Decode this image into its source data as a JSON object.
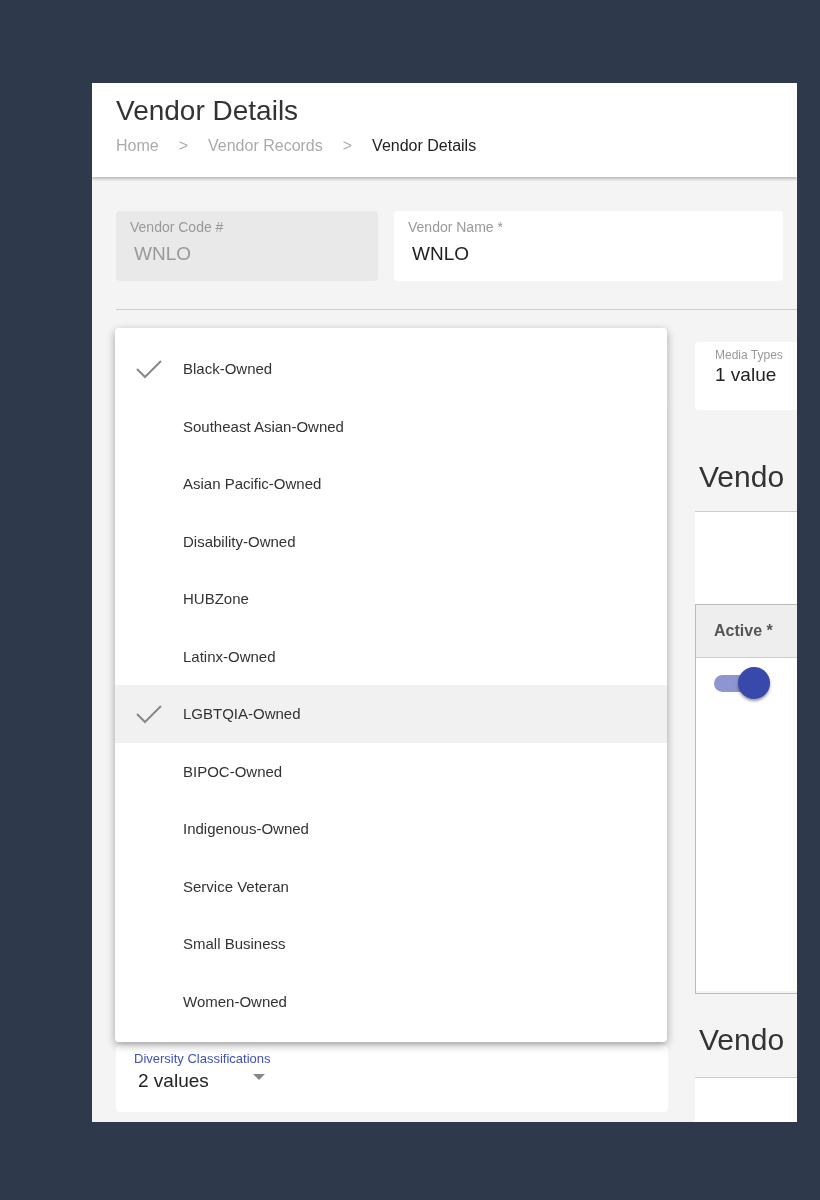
{
  "page_title": "Vendor Details",
  "breadcrumb": [
    {
      "label": "Home",
      "current": false
    },
    {
      "label": "Vendor Records",
      "current": false
    },
    {
      "label": "Vendor Details",
      "current": true
    }
  ],
  "breadcrumb_separator": ">",
  "fields": [
    {
      "label": "Vendor Code #",
      "value": "WNLO",
      "disabled": true
    },
    {
      "label": "Vendor Name *",
      "value": "WNLO",
      "disabled": false
    }
  ],
  "diversity_menu": [
    {
      "label": "Black-Owned",
      "checked": true,
      "highlighted": false
    },
    {
      "label": "Southeast Asian-Owned",
      "checked": false,
      "highlighted": false
    },
    {
      "label": "Asian Pacific-Owned",
      "checked": false,
      "highlighted": false
    },
    {
      "label": "Disability-Owned",
      "checked": false,
      "highlighted": false
    },
    {
      "label": "HUBZone",
      "checked": false,
      "highlighted": false
    },
    {
      "label": "Latinx-Owned",
      "checked": false,
      "highlighted": false
    },
    {
      "label": "LGBTQIA-Owned",
      "checked": true,
      "highlighted": true
    },
    {
      "label": "BIPOC-Owned",
      "checked": false,
      "highlighted": false
    },
    {
      "label": "Indigenous-Owned",
      "checked": false,
      "highlighted": false
    },
    {
      "label": "Service Veteran",
      "checked": false,
      "highlighted": false
    },
    {
      "label": "Small Business",
      "checked": false,
      "highlighted": false
    },
    {
      "label": "Women-Owned",
      "checked": false,
      "highlighted": false
    }
  ],
  "diversity_field": {
    "label": "Diversity Classifications",
    "value": "2 values"
  },
  "media_types_field": {
    "label": "Media Types",
    "value": "1 value"
  },
  "section_headings": [
    "Vendo",
    "Vendo"
  ],
  "table": {
    "columns": [
      "Active *"
    ],
    "rows": [
      {
        "active": true
      }
    ]
  }
}
